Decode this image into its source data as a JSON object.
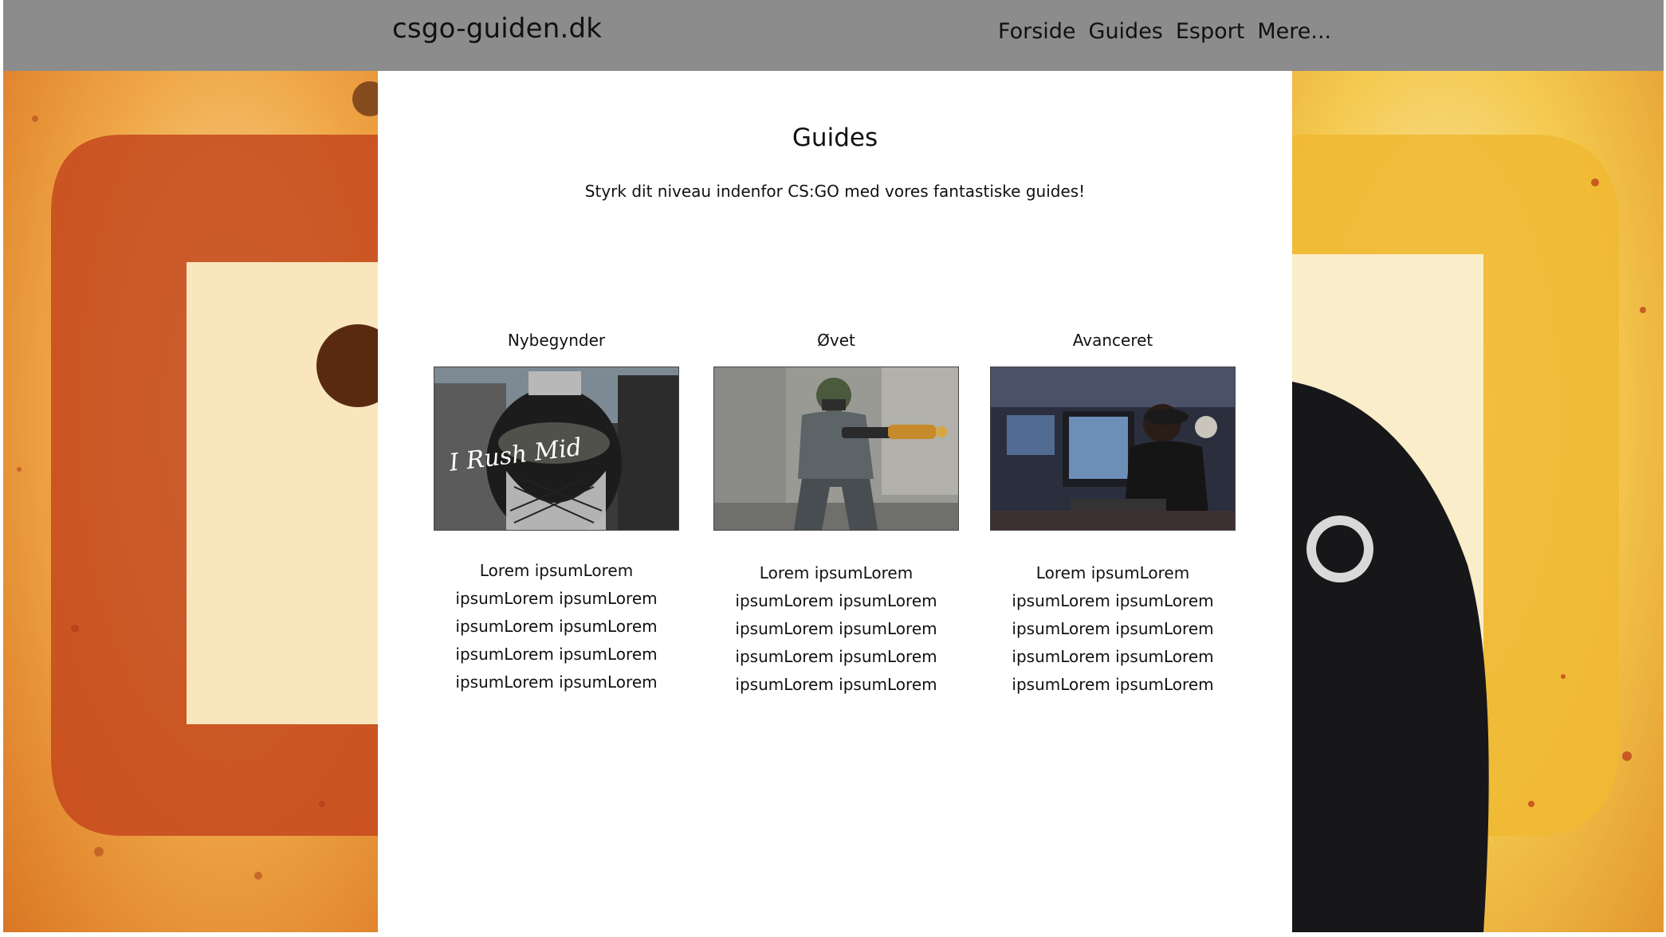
{
  "header": {
    "site_title": "csgo-guiden.dk",
    "nav": [
      {
        "label": "Forside"
      },
      {
        "label": "Guides"
      },
      {
        "label": "Esport"
      },
      {
        "label": "Mere..."
      }
    ]
  },
  "main": {
    "title": "Guides",
    "subtitle": "Styrk dit niveau indenfor CS:GO med vores fantastiske guides!",
    "cards": [
      {
        "label": "Nybegynder",
        "image_caption": "I Rush Mid",
        "text_lines": [
          "Lorem ipsumLorem",
          "ipsumLorem ipsumLorem",
          "ipsumLorem ipsumLorem",
          "ipsumLorem ipsumLorem",
          "ipsumLorem ipsumLorem"
        ]
      },
      {
        "label": "Øvet",
        "text_lines": [
          "Lorem ipsumLorem",
          "ipsumLorem ipsumLorem",
          "ipsumLorem ipsumLorem",
          "ipsumLorem ipsumLorem",
          "ipsumLorem ipsumLorem"
        ]
      },
      {
        "label": "Avanceret",
        "text_lines": [
          "Lorem ipsumLorem",
          "ipsumLorem ipsumLorem",
          "ipsumLorem ipsumLorem",
          "ipsumLorem ipsumLorem",
          "ipsumLorem ipsumLorem"
        ]
      }
    ]
  },
  "colors": {
    "header_bg": "#8c8c8c",
    "content_bg": "#ffffff",
    "background_orange": "#e8922a",
    "background_yellow": "#f2c84a"
  }
}
